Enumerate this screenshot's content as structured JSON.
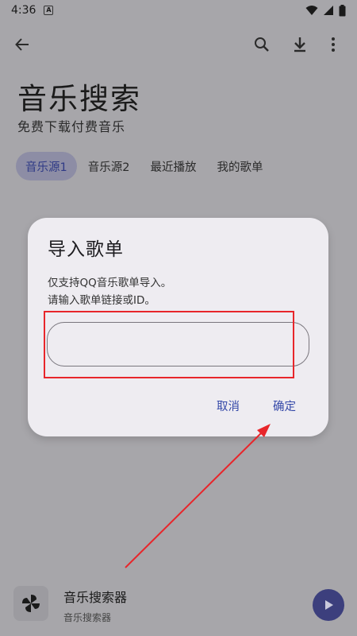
{
  "status_bar": {
    "time": "4:36",
    "notification_icon": "A-badge"
  },
  "page": {
    "title": "音乐搜索",
    "subtitle": "免费下载付费音乐"
  },
  "tabs": [
    {
      "label": "音乐源1",
      "active": true
    },
    {
      "label": "音乐源2",
      "active": false
    },
    {
      "label": "最近播放",
      "active": false
    },
    {
      "label": "我的歌单",
      "active": false
    }
  ],
  "dialog": {
    "title": "导入歌单",
    "line1": "仅支持QQ音乐歌单导入。",
    "line2": "请输入歌单链接或ID。",
    "input_value": "",
    "cancel_label": "取消",
    "confirm_label": "确定"
  },
  "player": {
    "title": "音乐搜索器",
    "subtitle": "音乐搜索器"
  },
  "colors": {
    "accent": "#3448a8",
    "annotation_red": "#e8262b",
    "play_button": "#3c3f7d"
  }
}
